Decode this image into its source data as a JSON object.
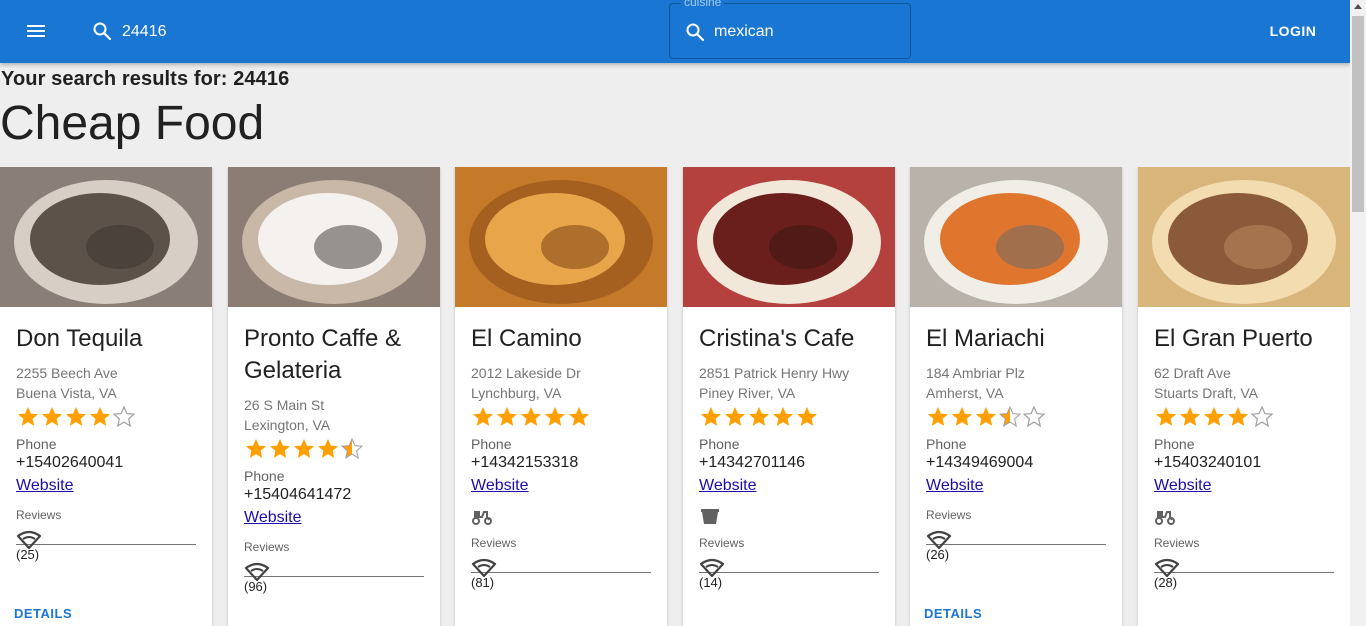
{
  "header": {
    "zip_value": "24416",
    "cuisine_label": "cuisine",
    "cuisine_value": "mexican",
    "login_label": "LOGIN"
  },
  "results_for": "Your search results for: 24416",
  "section_title": "Cheap Food",
  "colors": {
    "appbar": "#1976d2",
    "star": "#ffa000",
    "link": "#1a0dab",
    "details": "#1976d2"
  },
  "labels": {
    "phone": "Phone",
    "reviews": "Reviews",
    "website": "Website",
    "details": "DETAILS"
  },
  "restaurants": [
    {
      "name": "Don Tequila",
      "addr1": "2255 Beech Ave",
      "addr2": "Buena Vista, VA",
      "rating": 4,
      "phone": "+15402640041",
      "service_icon": "",
      "reviews": "(25)",
      "details": true
    },
    {
      "name": "Pronto Caffe & Gelateria",
      "addr1": "26 S Main St",
      "addr2": "Lexington, VA",
      "rating": 4.5,
      "phone": "+15404641472",
      "service_icon": "",
      "reviews": "(96)",
      "details": false
    },
    {
      "name": "El Camino",
      "addr1": "2012 Lakeside Dr",
      "addr2": "Lynchburg, VA",
      "rating": 5,
      "phone": "+14342153318",
      "service_icon": "delivery-scooter-icon",
      "reviews": "(81)",
      "details": false
    },
    {
      "name": "Cristina's Cafe",
      "addr1": "2851 Patrick Henry Hwy",
      "addr2": "Piney River, VA",
      "rating": 5,
      "phone": "+14342701146",
      "service_icon": "takeout-box-icon",
      "reviews": "(14)",
      "details": false
    },
    {
      "name": "El Mariachi",
      "addr1": "184 Ambriar Plz",
      "addr2": "Amherst, VA",
      "rating": 3.5,
      "phone": "+14349469004",
      "service_icon": "",
      "reviews": "(26)",
      "details": true
    },
    {
      "name": "El Gran Puerto",
      "addr1": "62 Draft Ave",
      "addr2": "Stuarts Draft, VA",
      "rating": 4,
      "phone": "+15403240101",
      "service_icon": "delivery-scooter-icon",
      "reviews": "(28)",
      "details": false
    }
  ]
}
